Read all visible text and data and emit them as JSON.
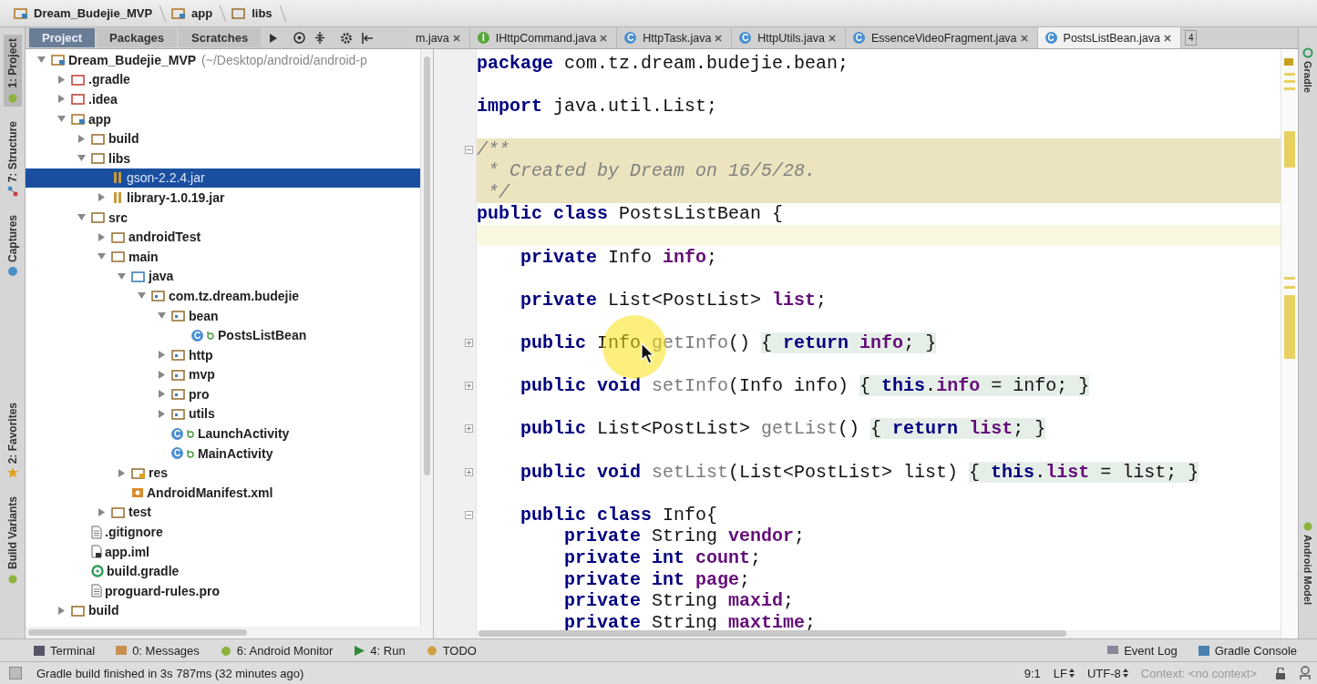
{
  "breadcrumbs": [
    {
      "label": "Dream_Budejie_MVP",
      "kind": "module"
    },
    {
      "label": "app",
      "kind": "module"
    },
    {
      "label": "libs",
      "kind": "folder"
    }
  ],
  "side_tabs_left": [
    {
      "label": "1: Project",
      "kind": "android",
      "selected": true
    },
    {
      "label": "7: Structure",
      "kind": "structure",
      "selected": false
    },
    {
      "label": "Captures",
      "kind": "camera",
      "selected": false
    },
    {
      "label": "2: Favorites",
      "kind": "star",
      "selected": false
    },
    {
      "label": "Build Variants",
      "kind": "android",
      "selected": false
    }
  ],
  "side_tabs_right": [
    {
      "label": "Gradle",
      "kind": "gradle"
    },
    {
      "label": "Android Model",
      "kind": "android"
    }
  ],
  "project_views": [
    {
      "label": "Project",
      "selected": true
    },
    {
      "label": "Packages",
      "selected": false
    },
    {
      "label": "Scratches",
      "selected": false
    }
  ],
  "tree": [
    {
      "label": "Dream_Budejie_MVP",
      "note": "(~/Desktop/android/android-p",
      "kind": "module",
      "expanded": true,
      "selected": false,
      "children": [
        {
          "label": ".gradle",
          "kind": "excluded",
          "expanded": false,
          "selected": false
        },
        {
          "label": ".idea",
          "kind": "excluded",
          "expanded": false,
          "selected": false
        },
        {
          "label": "app",
          "kind": "module",
          "expanded": true,
          "selected": false,
          "children": [
            {
              "label": "build",
              "kind": "folder",
              "expanded": false,
              "selected": false
            },
            {
              "label": "libs",
              "kind": "folder",
              "expanded": true,
              "selected": false,
              "children": [
                {
                  "label": "gson-2.2.4.jar",
                  "kind": "jar",
                  "selected": true
                },
                {
                  "label": "library-1.0.19.jar",
                  "kind": "jar",
                  "expanded": false,
                  "selected": false
                }
              ]
            },
            {
              "label": "src",
              "kind": "folder",
              "expanded": true,
              "selected": false,
              "children": [
                {
                  "label": "androidTest",
                  "kind": "folder",
                  "expanded": false,
                  "selected": false
                },
                {
                  "label": "main",
                  "kind": "folder",
                  "expanded": true,
                  "selected": false,
                  "children": [
                    {
                      "label": "java",
                      "kind": "source",
                      "expanded": true,
                      "selected": false,
                      "children": [
                        {
                          "label": "com.tz.dream.budejie",
                          "kind": "package",
                          "expanded": true,
                          "selected": false,
                          "children": [
                            {
                              "label": "bean",
                              "kind": "package",
                              "expanded": true,
                              "selected": false,
                              "children": [
                                {
                                  "label": "PostsListBean",
                                  "kind": "class",
                                  "badge": "C",
                                  "selected": false
                                }
                              ]
                            },
                            {
                              "label": "http",
                              "kind": "package",
                              "expanded": false,
                              "selected": false
                            },
                            {
                              "label": "mvp",
                              "kind": "package",
                              "expanded": false,
                              "selected": false
                            },
                            {
                              "label": "pro",
                              "kind": "package",
                              "expanded": false,
                              "selected": false
                            },
                            {
                              "label": "utils",
                              "kind": "package",
                              "expanded": false,
                              "selected": false
                            },
                            {
                              "label": "LaunchActivity",
                              "kind": "class",
                              "badge": "C",
                              "selected": false
                            },
                            {
                              "label": "MainActivity",
                              "kind": "class",
                              "badge": "C",
                              "selected": false
                            }
                          ]
                        }
                      ]
                    },
                    {
                      "label": "res",
                      "kind": "res",
                      "expanded": false,
                      "selected": false
                    },
                    {
                      "label": "AndroidManifest.xml",
                      "kind": "manifest",
                      "selected": false
                    }
                  ]
                },
                {
                  "label": "test",
                  "kind": "folder",
                  "expanded": false,
                  "selected": false
                }
              ]
            },
            {
              "label": ".gitignore",
              "kind": "text",
              "selected": false
            },
            {
              "label": "app.iml",
              "kind": "iml",
              "selected": false
            },
            {
              "label": "build.gradle",
              "kind": "gradle",
              "selected": false
            },
            {
              "label": "proguard-rules.pro",
              "kind": "text",
              "selected": false
            }
          ]
        },
        {
          "label": "build",
          "kind": "folder",
          "expanded": false,
          "selected": false
        }
      ]
    }
  ],
  "editor_tabs": [
    {
      "label": "m.java",
      "selected": false
    },
    {
      "label": "IHttpCommand.java",
      "badge": "I",
      "selected": false
    },
    {
      "label": "HttpTask.java",
      "badge": "C",
      "selected": false
    },
    {
      "label": "HttpUtils.java",
      "badge": "C",
      "selected": false
    },
    {
      "label": "EssenceVideoFragment.java",
      "badge": "C",
      "selected": false
    },
    {
      "label": "PostsListBean.java",
      "badge": "C",
      "selected": true
    }
  ],
  "tab_count": "4",
  "code": [
    {
      "kind": "code",
      "tokens": [
        {
          "kind": "kw",
          "text": "package"
        },
        {
          "kind": "plain",
          "text": " com.tz.dream.budejie.bean;"
        }
      ]
    },
    {
      "kind": "blank"
    },
    {
      "kind": "code",
      "tokens": [
        {
          "kind": "kw",
          "text": "import"
        },
        {
          "kind": "plain",
          "text": " java.util.List;"
        }
      ]
    },
    {
      "kind": "blank"
    },
    {
      "kind": "doc",
      "tokens": [
        {
          "kind": "comment",
          "text": "/**"
        }
      ]
    },
    {
      "kind": "doc",
      "tokens": [
        {
          "kind": "comment",
          "text": " * Created by Dream on 16/5/28."
        }
      ]
    },
    {
      "kind": "doc",
      "tokens": [
        {
          "kind": "comment",
          "text": " */"
        }
      ]
    },
    {
      "kind": "code",
      "tokens": [
        {
          "kind": "kw",
          "text": "public class"
        },
        {
          "kind": "plain",
          "text": " PostsListBean {"
        }
      ]
    },
    {
      "kind": "current"
    },
    {
      "kind": "code",
      "tokens": [
        {
          "kind": "kw",
          "text": "    private"
        },
        {
          "kind": "plain",
          "text": " Info "
        },
        {
          "kind": "field",
          "text": "info"
        },
        {
          "kind": "plain",
          "text": ";"
        }
      ]
    },
    {
      "kind": "blank"
    },
    {
      "kind": "code",
      "tokens": [
        {
          "kind": "kw",
          "text": "    private"
        },
        {
          "kind": "plain",
          "text": " List<PostList> "
        },
        {
          "kind": "field",
          "text": "list"
        },
        {
          "kind": "plain",
          "text": ";"
        }
      ]
    },
    {
      "kind": "blank"
    },
    {
      "kind": "code",
      "tokens": [
        {
          "kind": "kw",
          "text": "    public"
        },
        {
          "kind": "plain",
          "text": " Info "
        },
        {
          "kind": "method",
          "text": "getInfo"
        },
        {
          "kind": "plain",
          "text": "() "
        },
        {
          "kind": "fold",
          "text": "{ "
        },
        {
          "kind": "fold-kw",
          "text": "return"
        },
        {
          "kind": "fold-field",
          "text": " info"
        },
        {
          "kind": "fold",
          "text": "; }"
        }
      ]
    },
    {
      "kind": "blank"
    },
    {
      "kind": "code",
      "tokens": [
        {
          "kind": "kw",
          "text": "    public void"
        },
        {
          "kind": "method",
          "text": " setInfo"
        },
        {
          "kind": "plain",
          "text": "(Info info) "
        },
        {
          "kind": "fold",
          "text": "{ "
        },
        {
          "kind": "fold-kw",
          "text": "this"
        },
        {
          "kind": "fold",
          "text": "."
        },
        {
          "kind": "fold-field",
          "text": "info"
        },
        {
          "kind": "fold",
          "text": " = info; }"
        }
      ]
    },
    {
      "kind": "blank"
    },
    {
      "kind": "code",
      "tokens": [
        {
          "kind": "kw",
          "text": "    public"
        },
        {
          "kind": "plain",
          "text": " List<PostList> "
        },
        {
          "kind": "method",
          "text": "getList"
        },
        {
          "kind": "plain",
          "text": "() "
        },
        {
          "kind": "fold",
          "text": "{ "
        },
        {
          "kind": "fold-kw",
          "text": "return"
        },
        {
          "kind": "fold-field",
          "text": " list"
        },
        {
          "kind": "fold",
          "text": "; }"
        }
      ]
    },
    {
      "kind": "blank"
    },
    {
      "kind": "code",
      "tokens": [
        {
          "kind": "kw",
          "text": "    public void"
        },
        {
          "kind": "method",
          "text": " setList"
        },
        {
          "kind": "plain",
          "text": "(List<PostList> list) "
        },
        {
          "kind": "fold",
          "text": "{ "
        },
        {
          "kind": "fold-kw",
          "text": "this"
        },
        {
          "kind": "fold",
          "text": "."
        },
        {
          "kind": "fold-field",
          "text": "list"
        },
        {
          "kind": "fold",
          "text": " = list; }"
        }
      ]
    },
    {
      "kind": "blank"
    },
    {
      "kind": "code",
      "tokens": [
        {
          "kind": "kw",
          "text": "    public class"
        },
        {
          "kind": "plain",
          "text": " Info{"
        }
      ]
    },
    {
      "kind": "code",
      "tokens": [
        {
          "kind": "kw",
          "text": "        private"
        },
        {
          "kind": "plain",
          "text": " String "
        },
        {
          "kind": "field",
          "text": "vendor"
        },
        {
          "kind": "plain",
          "text": ";"
        }
      ]
    },
    {
      "kind": "code",
      "tokens": [
        {
          "kind": "kw",
          "text": "        private int"
        },
        {
          "kind": "field",
          "text": " count"
        },
        {
          "kind": "plain",
          "text": ";"
        }
      ]
    },
    {
      "kind": "code",
      "tokens": [
        {
          "kind": "kw",
          "text": "        private int"
        },
        {
          "kind": "field",
          "text": " page"
        },
        {
          "kind": "plain",
          "text": ";"
        }
      ]
    },
    {
      "kind": "code",
      "tokens": [
        {
          "kind": "kw",
          "text": "        private"
        },
        {
          "kind": "plain",
          "text": " String "
        },
        {
          "kind": "field",
          "text": "maxid"
        },
        {
          "kind": "plain",
          "text": ";"
        }
      ]
    },
    {
      "kind": "code",
      "tokens": [
        {
          "kind": "kw",
          "text": "        private"
        },
        {
          "kind": "plain",
          "text": " String "
        },
        {
          "kind": "field",
          "text": "maxtime"
        },
        {
          "kind": "plain",
          "text": ";"
        }
      ]
    }
  ],
  "bottom_tools": [
    {
      "label": "Terminal",
      "kind": "terminal"
    },
    {
      "label": "0: Messages",
      "kind": "messages"
    },
    {
      "label": "6: Android Monitor",
      "kind": "android"
    },
    {
      "label": "4: Run",
      "kind": "run"
    },
    {
      "label": "TODO",
      "kind": "todo"
    }
  ],
  "bottom_tools_right": [
    {
      "label": "Event Log",
      "kind": "messages"
    },
    {
      "label": "Gradle Console",
      "kind": "terminal"
    }
  ],
  "status_bar": {
    "message": "Gradle build finished in 3s 787ms (32 minutes ago)",
    "position": "9:1",
    "line_separator": "LF",
    "encoding": "UTF-8",
    "context": "Context: <no context>"
  }
}
